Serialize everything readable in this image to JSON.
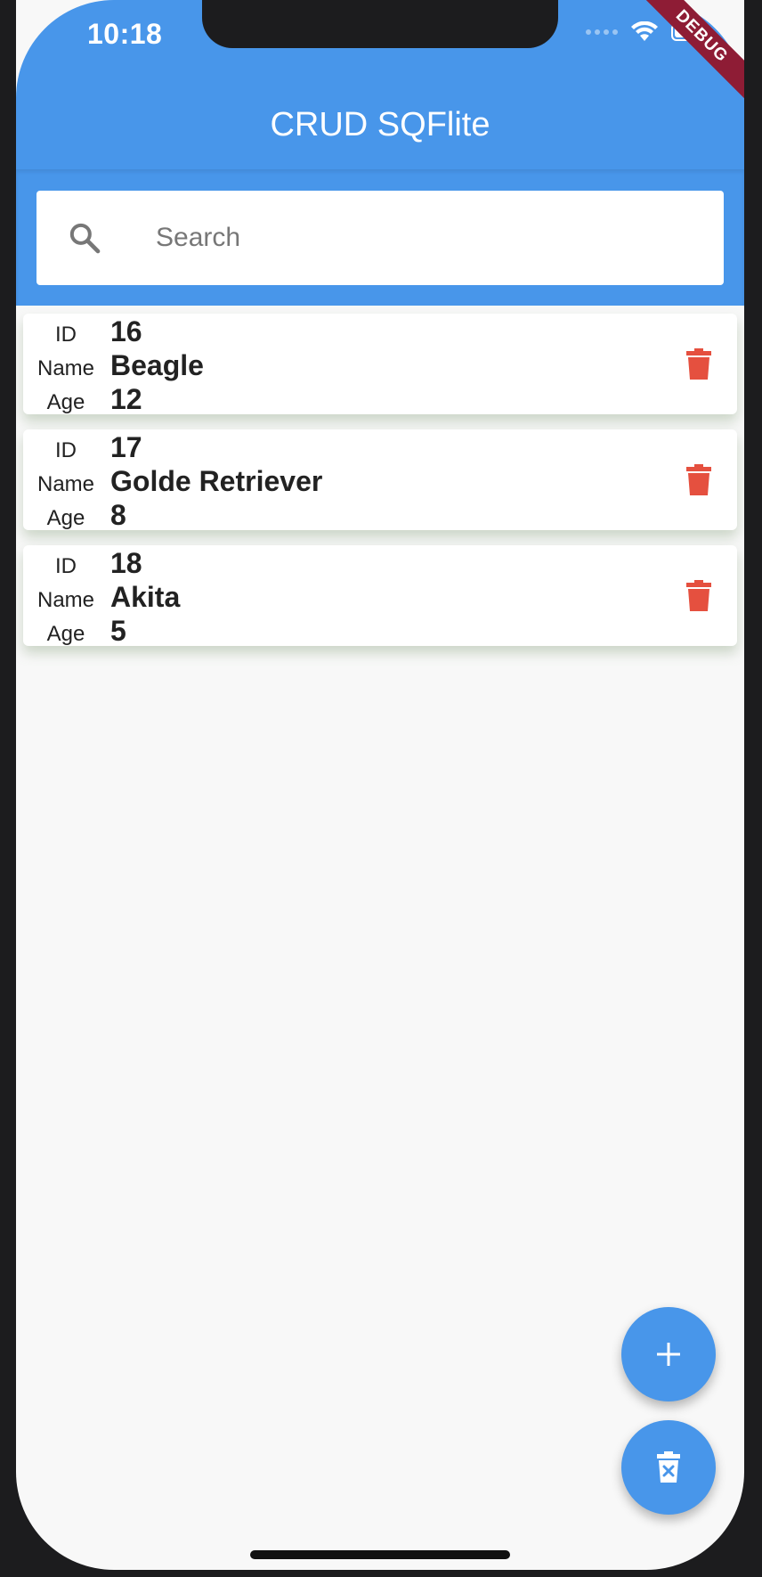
{
  "status_bar": {
    "time": "10:18"
  },
  "debug_banner": "DEBUG",
  "app_bar": {
    "title": "CRUD SQFlite",
    "color": "#4896ea"
  },
  "search": {
    "placeholder": "Search",
    "value": "",
    "icon": "search-icon"
  },
  "labels": {
    "id": "ID",
    "name": "Name",
    "age": "Age"
  },
  "records": [
    {
      "id": "16",
      "name": "Beagle",
      "age": "12"
    },
    {
      "id": "17",
      "name": "Golde Retriever",
      "age": "8"
    },
    {
      "id": "18",
      "name": "Akita",
      "age": "5"
    }
  ],
  "row_action_icon": "trash-icon",
  "delete_color": "#e5503f",
  "fab": {
    "add_icon": "plus-icon",
    "clear_icon": "clear-all-icon"
  }
}
